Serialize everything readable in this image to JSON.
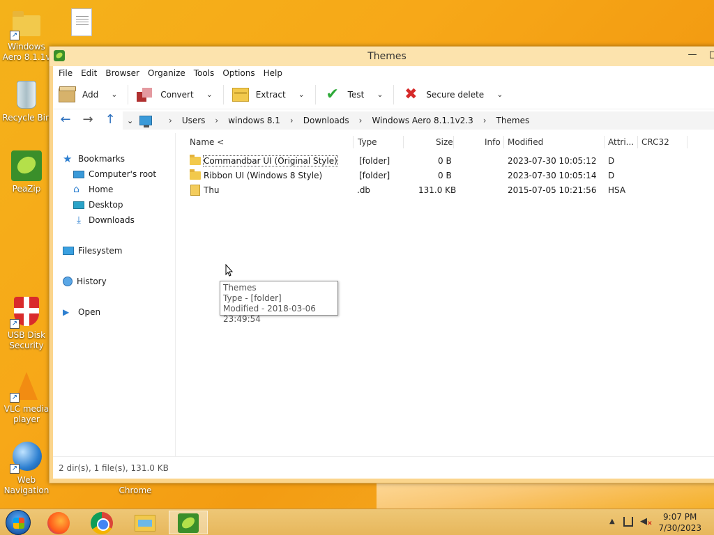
{
  "desktop": {
    "icons": [
      {
        "label": "Windows Aero 8.1.1v",
        "icon": "folder-icon"
      },
      {
        "label": "...",
        "icon": "document-icon"
      },
      {
        "label": "Recycle Bin",
        "icon": "recycle-bin-icon"
      },
      {
        "label": "PeaZip",
        "icon": "peazip-icon"
      },
      {
        "label": "USB Disk Security",
        "icon": "usb-disk-security-icon"
      },
      {
        "label": "VLC media player",
        "icon": "vlc-icon"
      },
      {
        "label": "Web Navigation",
        "icon": "web-navigation-icon"
      },
      {
        "label": "Chrome",
        "icon": "chrome-label"
      }
    ]
  },
  "window": {
    "title": "Themes",
    "minimize": "—",
    "maximize": "□"
  },
  "menu": [
    "File",
    "Edit",
    "Browser",
    "Organize",
    "Tools",
    "Options",
    "Help"
  ],
  "toolbar": {
    "add": "Add",
    "convert": "Convert",
    "extract": "Extract",
    "test": "Test",
    "secure_delete": "Secure delete",
    "chevron": "⌄"
  },
  "address": {
    "back": "←",
    "forward": "→",
    "up": "↑",
    "crumbs": [
      "Users",
      "windows 8.1",
      "Downloads",
      "Windows Aero 8.1.1v2.3",
      "Themes"
    ],
    "separator": "›"
  },
  "sidebar": {
    "bookmarks": "Bookmarks",
    "computer_root": "Computer's root",
    "home": "Home",
    "desktop": "Desktop",
    "downloads": "Downloads",
    "filesystem": "Filesystem",
    "history": "History",
    "open": "Open"
  },
  "columns": {
    "name": "Name <",
    "type": "Type",
    "size": "Size",
    "info": "Info",
    "modified": "Modified",
    "attributes": "Attri...",
    "crc32": "CRC32"
  },
  "files": [
    {
      "name": "Commandbar UI (Original Style)",
      "type": "[folder]",
      "size": "0 B",
      "modified": "2023-07-30 10:05:12",
      "attr": "D"
    },
    {
      "name": "Ribbon UI (Windows 8 Style)",
      "type": "[folder]",
      "size": "0 B",
      "modified": "2023-07-30 10:05:14",
      "attr": "D"
    },
    {
      "name": "Thu",
      "type": ".db",
      "size": "131.0 KB",
      "modified": "2015-07-05 10:21:56",
      "attr": "HSA"
    }
  ],
  "tooltip": {
    "line1": "Themes",
    "line2": "Type -  [folder]",
    "line3": "Modified - 2018-03-06 23:49:54"
  },
  "status": "2 dir(s), 1 file(s), 131.0 KB",
  "clock": {
    "time": "9:07 PM",
    "date": "7/30/2023"
  }
}
